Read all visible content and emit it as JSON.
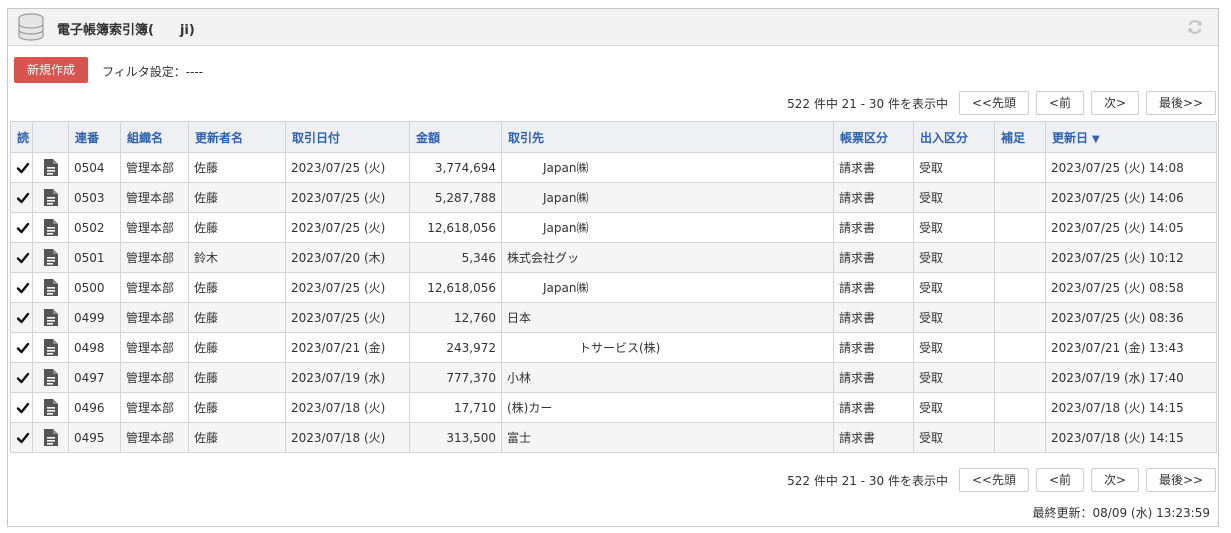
{
  "header": {
    "title": "電子帳簿索引簿(　　ji)",
    "db_icon": "database-icon",
    "refresh_icon": "refresh-icon"
  },
  "toolbar": {
    "new_label": "新規作成",
    "filter_label": "フィルタ設定：----"
  },
  "pager": {
    "info": "522 件中 21 - 30 件を表示中",
    "first": "<<先頭",
    "prev": "<前",
    "next": "次>",
    "last": "最後>>"
  },
  "columns": [
    "読",
    "",
    "連番",
    "組織名",
    "更新者名",
    "取引日付",
    "金額",
    "取引先",
    "帳票区分",
    "出入区分",
    "補足",
    "更新日"
  ],
  "sort_indicator": "▼",
  "rows": [
    {
      "no": "0504",
      "org": "管理本部",
      "user": "佐藤",
      "date": "2023/07/25 (火)",
      "amount": "3,774,694",
      "partner": "Japan㈱",
      "type": "請求書",
      "io": "受取",
      "note": "",
      "updated": "2023/07/25 (火) 14:08"
    },
    {
      "no": "0503",
      "org": "管理本部",
      "user": "佐藤",
      "date": "2023/07/25 (火)",
      "amount": "5,287,788",
      "partner": "Japan㈱",
      "type": "請求書",
      "io": "受取",
      "note": "",
      "updated": "2023/07/25 (火) 14:06"
    },
    {
      "no": "0502",
      "org": "管理本部",
      "user": "佐藤",
      "date": "2023/07/25 (火)",
      "amount": "12,618,056",
      "partner": "Japan㈱",
      "type": "請求書",
      "io": "受取",
      "note": "",
      "updated": "2023/07/25 (火) 14:05"
    },
    {
      "no": "0501",
      "org": "管理本部",
      "user": "鈴木",
      "date": "2023/07/20 (木)",
      "amount": "5,346",
      "partner": "株式会社グッ",
      "type": "請求書",
      "io": "受取",
      "note": "",
      "updated": "2023/07/25 (火) 10:12"
    },
    {
      "no": "0500",
      "org": "管理本部",
      "user": "佐藤",
      "date": "2023/07/25 (火)",
      "amount": "12,618,056",
      "partner": "Japan㈱",
      "type": "請求書",
      "io": "受取",
      "note": "",
      "updated": "2023/07/25 (火) 08:58"
    },
    {
      "no": "0499",
      "org": "管理本部",
      "user": "佐藤",
      "date": "2023/07/25 (火)",
      "amount": "12,760",
      "partner": "日本",
      "type": "請求書",
      "io": "受取",
      "note": "",
      "updated": "2023/07/25 (火) 08:36"
    },
    {
      "no": "0498",
      "org": "管理本部",
      "user": "佐藤",
      "date": "2023/07/21 (金)",
      "amount": "243,972",
      "partner": "トサービス(株)",
      "type": "請求書",
      "io": "受取",
      "note": "",
      "updated": "2023/07/21 (金) 13:43"
    },
    {
      "no": "0497",
      "org": "管理本部",
      "user": "佐藤",
      "date": "2023/07/19 (水)",
      "amount": "777,370",
      "partner": "小林",
      "type": "請求書",
      "io": "受取",
      "note": "",
      "updated": "2023/07/19 (水) 17:40"
    },
    {
      "no": "0496",
      "org": "管理本部",
      "user": "佐藤",
      "date": "2023/07/18 (火)",
      "amount": "17,710",
      "partner": "(株)カー",
      "type": "請求書",
      "io": "受取",
      "note": "",
      "updated": "2023/07/18 (火) 14:15"
    },
    {
      "no": "0495",
      "org": "管理本部",
      "user": "佐藤",
      "date": "2023/07/18 (火)",
      "amount": "313,500",
      "partner": "富士",
      "type": "請求書",
      "io": "受取",
      "note": "",
      "updated": "2023/07/18 (火) 14:15"
    }
  ],
  "footer": {
    "last_update": "最終更新：08/09 (水) 13:23:59"
  },
  "colors": {
    "accent_red": "#d9534f",
    "header_blue": "#2d62b0",
    "header_bg": "#eef0f4"
  }
}
